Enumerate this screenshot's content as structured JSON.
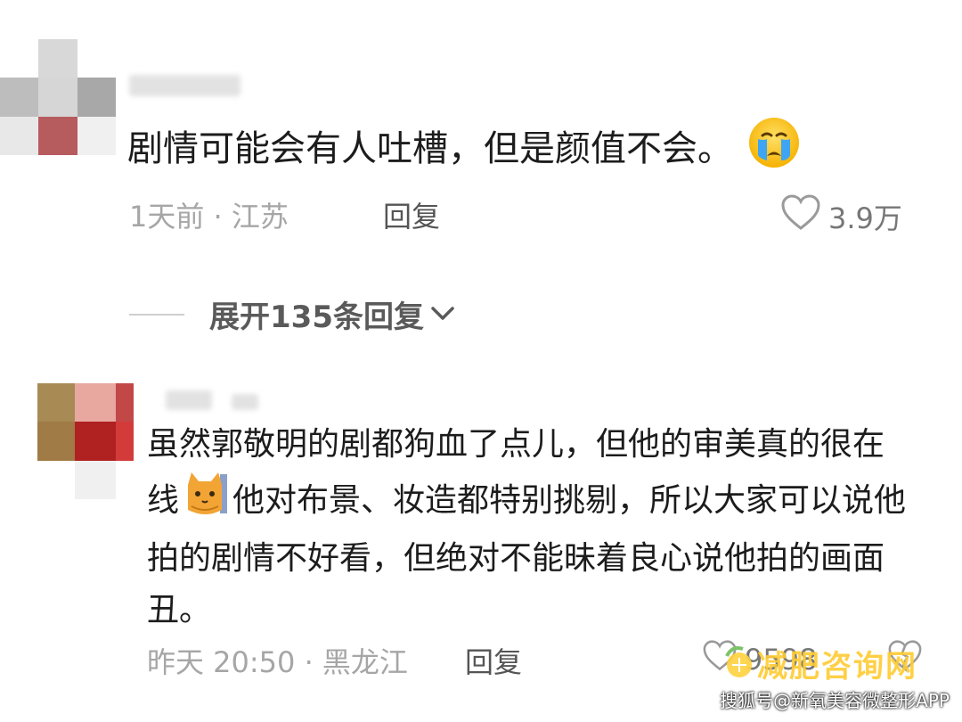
{
  "comments": [
    {
      "username_blurred": "",
      "text": "剧情可能会有人吐槽，但是颜值不会。",
      "emoji_icon": "crying-face-icon",
      "time_location": "1天前 · 江苏",
      "reply_label": "回复",
      "likes": "3.9万"
    },
    {
      "username_blurred": "",
      "text_part1": "虽然郭敬明的剧都狗血了点儿，但他的审美真的很在线",
      "emoji_icon": "cat-face-icon",
      "text_part2": "他对布景、妆造都特别挑剔，所以大家可以说他拍的剧情不好看，但绝对不能昧着良心说他拍的画面丑。",
      "time_location": "昨天 20:50 · 黑龙江",
      "reply_label": "回复",
      "likes": "9598"
    }
  ],
  "expand_replies": "展开135条回复",
  "watermark": {
    "title": "减肥咨询网",
    "subtitle": "搜狐号@新氧美容微整形APP"
  },
  "colors": {
    "text": "#1c1c1c",
    "meta": "#a6a6a6",
    "watermark": "#ffcc33"
  }
}
